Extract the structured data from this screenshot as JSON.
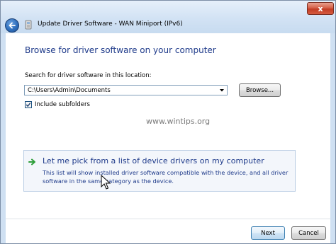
{
  "window": {
    "title": "Update Driver Software - WAN Miniport (IPv6)",
    "close_label": "x"
  },
  "content": {
    "heading": "Browse for driver software on your computer",
    "search_label": "Search for driver software in this location:",
    "path_value": "C:\\Users\\Admin\\Documents",
    "browse_label": "Browse...",
    "include_subfolders": {
      "label": "Include subfolders",
      "checked": true
    },
    "watermark": "www.wintips.org",
    "pick_option": {
      "title": "Let me pick from a list of device drivers on my computer",
      "description_line_1": "This list will show installed driver software compatible with the device, and all driver",
      "description_line_2": "software in the same category as the device."
    }
  },
  "footer": {
    "next_label": "Next",
    "cancel_label": "Cancel"
  },
  "icons": {
    "back": "back-arrow-icon",
    "title": "device-driver-icon",
    "option_arrow": "green-arrow-icon",
    "cursor": "mouse-pointer-icon",
    "dropdown": "chevron-down-icon",
    "checkmark": "checkmark-icon"
  },
  "colors": {
    "link_blue": "#1e3a8a",
    "option_arrow_green": "#2e9e3a",
    "window_frame": "#cfe0f2"
  }
}
